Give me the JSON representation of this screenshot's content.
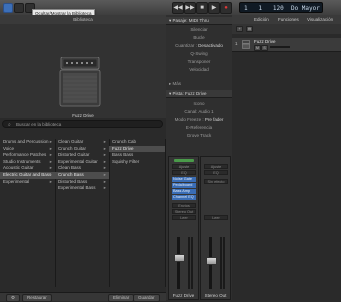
{
  "toolbar": {
    "tooltip": "Ocultar/Mostrar la Biblioteca",
    "transport": {
      "rewind": "◀◀",
      "forward": "▶▶",
      "stop": "■",
      "play": "▶",
      "record": "●"
    },
    "lcd": "1   1   120  Do Mayor",
    "colors": {
      "accent": "#3c6fb8",
      "record": "#e03a3a"
    }
  },
  "library": {
    "title": "Biblioteca",
    "patch_name": "Fuzz Drive",
    "search_placeholder": "Buscar en la biblioteca",
    "col1": [
      {
        "label": "Drums and Percussion"
      },
      {
        "label": "Voice"
      },
      {
        "label": "Performance Patches"
      },
      {
        "label": "Studio Instruments"
      },
      {
        "label": "Acoustic Guitar"
      },
      {
        "label": "Electric Guitar and Bass",
        "selected": true
      },
      {
        "label": "Experimental"
      }
    ],
    "col2": [
      {
        "label": "Clean Guitar"
      },
      {
        "label": "Crunch Guitar"
      },
      {
        "label": "Distorted Guitar"
      },
      {
        "label": "Experimental Guitar"
      },
      {
        "label": "Clean Bass"
      },
      {
        "label": "Crunch Bass",
        "selected": true
      },
      {
        "label": "Distorted Bass"
      },
      {
        "label": "Experimental Bass"
      }
    ],
    "col3": [
      {
        "label": "Crunch Cab"
      },
      {
        "label": "Fuzz Drive",
        "selected": true
      },
      {
        "label": "Bass Bass"
      },
      {
        "label": "Squishy Filter"
      }
    ],
    "footer": {
      "restore": "Restaurar",
      "delete": "Eliminar",
      "save": "Guardar"
    }
  },
  "inspector": {
    "region_header": "Pasaje: MIDI Thru",
    "region_rows": [
      {
        "label": "Silenciar"
      },
      {
        "label": "Bucle"
      },
      {
        "label": "Cuantizar",
        "value": "Desactivado"
      },
      {
        "label": "Q-Swing"
      },
      {
        "label": "Transponer"
      },
      {
        "label": "Velocidad"
      }
    ],
    "more": "Más",
    "track_header": "Pista: Fuzz Drive",
    "track_rows": [
      {
        "label": "Icono"
      },
      {
        "label": "Canal: Audio 1"
      },
      {
        "label": "Modo Freeze",
        "value": "Pre fader"
      },
      {
        "label": "E-Referencia"
      },
      {
        "label": "Grove Track"
      }
    ],
    "strip_main": {
      "setting": "Ajuste",
      "eq": "EQ",
      "plugins": [
        "Noise Gate",
        "Pedalboard",
        "Bass Amp",
        "Channel EQ"
      ],
      "sends": "Envíos",
      "output": "Stereo Out",
      "mode": "Leer",
      "name": "Fuzz Drive",
      "fader_level": 0.62
    },
    "strip_out": {
      "setting": "Ajuste",
      "eq": "EQ",
      "slot": "Sin efecto",
      "mode": "Leer",
      "name": "Stereo Out",
      "fader_level": 0.55
    }
  },
  "tracks": {
    "menu": [
      "Edición",
      "Funciones",
      "Visualización"
    ],
    "track_name": "Fuzz Drive",
    "track_number": "1"
  }
}
